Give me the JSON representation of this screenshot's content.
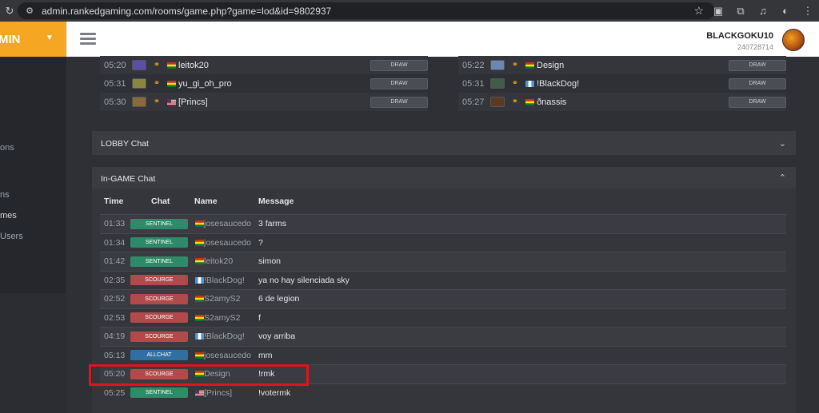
{
  "browser": {
    "url": "admin.rankedgaming.com/rooms/game.php?game=lod&id=9802937"
  },
  "sidebar": {
    "brand": "MIN",
    "items": [
      {
        "label": "ons",
        "active": false
      },
      {
        "label": "ns",
        "active": false
      },
      {
        "label": "mes",
        "active": true
      },
      {
        "label": "Users",
        "active": false
      }
    ]
  },
  "header": {
    "username": "BLACKGOKU10",
    "user_id": "240728714"
  },
  "players": {
    "draw_label": "DRAW",
    "left": [
      {
        "time": "05:20",
        "color": "#5b4ea8",
        "flag": "bolivia",
        "name": "leitok20"
      },
      {
        "time": "05:31",
        "color": "#8c8540",
        "flag": "bolivia",
        "name": "yu_gi_oh_pro"
      },
      {
        "time": "05:30",
        "color": "#8a6a3a",
        "flag": "usa",
        "name": "[Princs]"
      }
    ],
    "right": [
      {
        "time": "05:22",
        "color": "#6a88b5",
        "flag": "bolivia",
        "name": "Design"
      },
      {
        "time": "05:31",
        "color": "#3f5e45",
        "flag": "guatemala",
        "name": "!BlackDog!"
      },
      {
        "time": "05:27",
        "color": "#5a3a22",
        "flag": "bolivia",
        "name": "ðnassis"
      }
    ]
  },
  "lobby_chat": {
    "title": "LOBBY Chat"
  },
  "ingame_chat": {
    "title": "In-GAME Chat",
    "columns": [
      "Time",
      "Chat",
      "Name",
      "Message"
    ],
    "rows": [
      {
        "time": "01:33",
        "chat": "SENTINEL",
        "flag": "bolivia",
        "name": "josesaucedo",
        "message": "3 farms"
      },
      {
        "time": "01:34",
        "chat": "SENTINEL",
        "flag": "bolivia",
        "name": "josesaucedo",
        "message": "?"
      },
      {
        "time": "01:42",
        "chat": "SENTINEL",
        "flag": "bolivia",
        "name": "leitok20",
        "message": "simon"
      },
      {
        "time": "02:35",
        "chat": "SCOURGE",
        "flag": "guatemala",
        "name": "!BlackDog!",
        "message": "ya no hay silenciada sky"
      },
      {
        "time": "02:52",
        "chat": "SCOURGE",
        "flag": "bolivia",
        "name": "S2amyS2",
        "message": "6 de legion"
      },
      {
        "time": "02:53",
        "chat": "SCOURGE",
        "flag": "bolivia",
        "name": "S2amyS2",
        "message": "f"
      },
      {
        "time": "04:19",
        "chat": "SCOURGE",
        "flag": "guatemala",
        "name": "!BlackDog!",
        "message": "voy arriba"
      },
      {
        "time": "05:13",
        "chat": "ALLCHAT",
        "flag": "bolivia",
        "name": "josesaucedo",
        "message": "mm"
      },
      {
        "time": "05:20",
        "chat": "SCOURGE",
        "flag": "bolivia",
        "name": "Design",
        "message": "!rmk"
      },
      {
        "time": "05:25",
        "chat": "SENTINEL",
        "flag": "usa",
        "name": "[Princs]",
        "message": "!votermk"
      }
    ]
  },
  "colors": {
    "sentinel": "#2e8b6a",
    "scourge": "#b14a4a",
    "allchat": "#2f6fa3",
    "highlight": "#e4121a",
    "brand": "#f5a623"
  }
}
